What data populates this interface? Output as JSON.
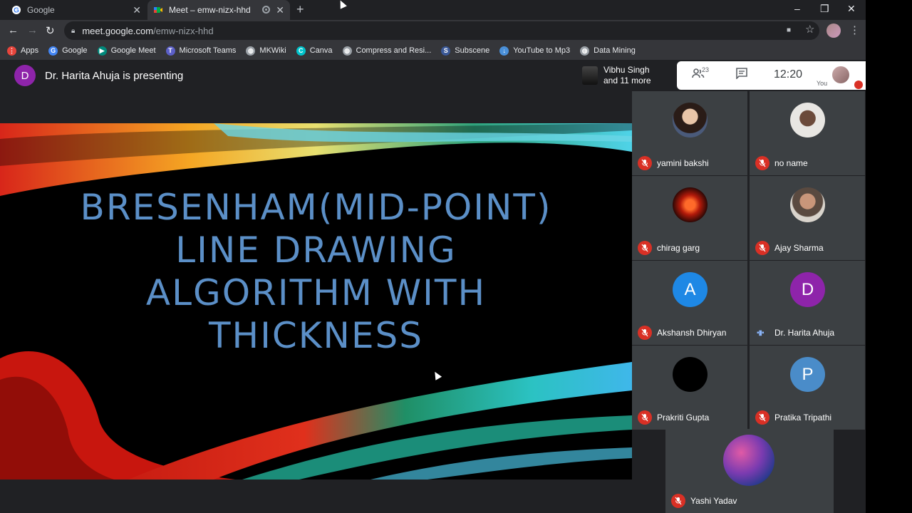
{
  "browser": {
    "tabs": [
      {
        "title": "Google",
        "icon": "google-icon",
        "active": false
      },
      {
        "title": "Meet – emw-nizx-hhd",
        "icon": "meet-icon",
        "active": true,
        "recording": true
      }
    ],
    "new_tab_label": "+",
    "window_controls": {
      "minimize": "–",
      "maximize": "❐",
      "close": "✕"
    },
    "nav": {
      "back": "←",
      "forward": "→",
      "reload": "↻"
    },
    "address": {
      "host": "meet.google.com",
      "path": "/emw-nizx-hhd"
    },
    "toolbar_icons": {
      "camera": "■",
      "star": "☆",
      "menu": "⋮"
    },
    "bookmarks": [
      {
        "label": "Apps",
        "icon": "apps-icon",
        "color": "#e8453c",
        "glyph": "⋮"
      },
      {
        "label": "Google",
        "icon": "google-icon",
        "color": "#4285f4",
        "glyph": "G"
      },
      {
        "label": "Google Meet",
        "icon": "meet-icon",
        "color": "#00897b",
        "glyph": "▶"
      },
      {
        "label": "Microsoft Teams",
        "icon": "teams-icon",
        "color": "#5b5fc7",
        "glyph": "T"
      },
      {
        "label": "MKWiki",
        "icon": "globe-icon",
        "color": "#9aa0a6",
        "glyph": "◍"
      },
      {
        "label": "Canva",
        "icon": "canva-icon",
        "color": "#00c4cc",
        "glyph": "C"
      },
      {
        "label": "Compress and Resi...",
        "icon": "globe-icon",
        "color": "#9aa0a6",
        "glyph": "◍"
      },
      {
        "label": "Subscene",
        "icon": "subscene-icon",
        "color": "#3b5998",
        "glyph": "S"
      },
      {
        "label": "YouTube to Mp3",
        "icon": "download-icon",
        "color": "#4a90d9",
        "glyph": "↓"
      },
      {
        "label": "Data Mining",
        "icon": "globe-icon",
        "color": "#9aa0a6",
        "glyph": "◍"
      }
    ]
  },
  "meet": {
    "presenter": {
      "initial": "D",
      "text": "Dr. Harita Ahuja is presenting",
      "color": "#8e24aa"
    },
    "top_bar": {
      "pinned_names": [
        "Vibhu Singh",
        "and 11 more"
      ],
      "participant_count": "23",
      "time": "12:20",
      "you_label": "You"
    },
    "slide": {
      "title_lines": [
        "BRESENHAM(MID-POINT)",
        "LINE DRAWING",
        "ALGORITHM WITH",
        "THICKNESS"
      ],
      "title_color": "#5b8fc7"
    },
    "participants": [
      {
        "name": "yamini bakshi",
        "avatar": "photo",
        "muted": true
      },
      {
        "name": "no name",
        "avatar": "photo",
        "muted": true
      },
      {
        "name": "chirag garg",
        "avatar": "photo",
        "muted": true
      },
      {
        "name": "Ajay Sharma",
        "avatar": "photo",
        "muted": true
      },
      {
        "name": "Akshansh Dhiryan",
        "avatar": "A",
        "color": "#1e88e5",
        "muted": true
      },
      {
        "name": "Dr. Harita Ahuja",
        "avatar": "D",
        "color": "#8e24aa",
        "muted": false,
        "speaking": true
      },
      {
        "name": "Prakriti Gupta",
        "avatar": "photo-dark",
        "muted": true
      },
      {
        "name": "Pratika Tripathi",
        "avatar": "P",
        "color": "#4a8cc9",
        "muted": true
      }
    ],
    "spotlight": {
      "name": "Yashi Yadav",
      "muted": true
    }
  }
}
